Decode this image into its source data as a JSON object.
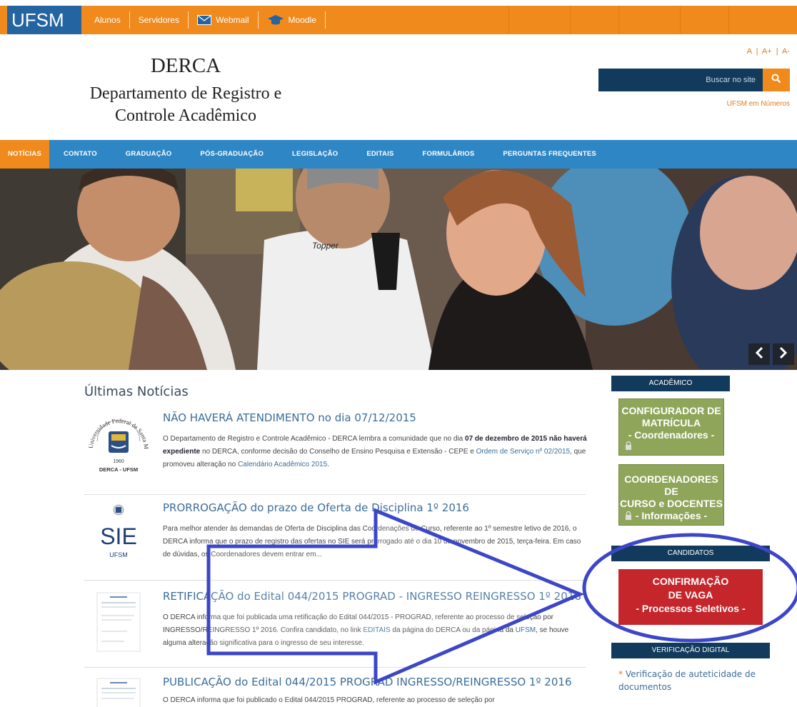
{
  "topbar": {
    "logo": "UFSM",
    "links": [
      "Alunos",
      "Servidores",
      "Webmail",
      "Moodle"
    ]
  },
  "header": {
    "title": "DERCA",
    "subtitle_line1": "Departamento de Registro e",
    "subtitle_line2": "Controle Acadêmico",
    "font_sizes": "A  |  A+  |  A-",
    "search_placeholder": "Buscar no site",
    "ufsm_numeros": "UFSM em Números"
  },
  "nav": {
    "items": [
      "NOTÍCIAS",
      "CONTATO",
      "GRADUAÇÃO",
      "PÓS-GRADUAÇÃO",
      "LEGISLAÇÃO",
      "EDITAIS",
      "FORMULÁRIOS",
      "PERGUNTAS FREQUENTES"
    ],
    "active": "NOTÍCIAS"
  },
  "hero": {
    "shirt_text": "Topper"
  },
  "news": {
    "heading": "Últimas Notícias",
    "items": [
      {
        "title": "NÃO HAVERÁ ATENDIMENTO no dia 07/12/2015",
        "text_1": "O Departamento de Registro e Controle Acadêmico - DERCA lembra a comunidade que no dia ",
        "bold_1": "07 de dezembro de 2015 não haverá expediente",
        "text_2": " no DERCA, conforme decisão do Conselho de Ensino Pesquisa e Extensão - CEPE e ",
        "link_1": "Ordem de Serviço nº 02/2015",
        "text_3": ", que promoveu alteração no ",
        "link_2": "Calendário Acadêmico 2015",
        "text_4": ".",
        "thumb_seal_text": "Universidade Federal de Santa Maria",
        "thumb_year": "1960",
        "thumb_caption": "DERCA - UFSM"
      },
      {
        "title": "PRORROGAÇÃO do prazo de Oferta de Disciplina 1º 2016",
        "text": "Para melhor atender às demandas de Oferta de Disciplina das Coordenações de Curso, referente ao 1º semestre letivo de 2016, o DERCA informa que o prazo de registro das ofertas no SIE será prorrogado até o dia 10 de novembro de 2015, terça-feira. Em caso de dúvidas, os Coordenadores devem entrar em...",
        "thumb_big": "SIE",
        "thumb_small": "UFSM"
      },
      {
        "title": "RETIFICAÇÃO do Edital 044/2015 PROGRAD - INGRESSO REINGRESSO 1º 2016",
        "text_1": "O DERCA informa que foi publicada uma retificação do Edital 044/2015 - PROGRAD, referente ao processo de seleção por INGRESSO/REINGRESSO 1º 2016. Confira candidato, no link ",
        "link_1": "EDITAIS",
        "text_2": " da página do DERCA ou da página da ",
        "link_2": "UFSM",
        "text_3": ", se houve alguma alteração significativa para o ingresso de seu interesse."
      },
      {
        "title": "PUBLICAÇÃO do Edital 044/2015 PROGRAD INGRESSO/REINGRESSO 1º 2016",
        "text": "O DERCA informa que foi publicado o Edital 044/2015 PROGRAD, referente ao processo de seleção por"
      }
    ]
  },
  "sidebar": {
    "academico_head": "ACADÊMICO",
    "box1": [
      "CONFIGURADOR DE",
      "MATRÍCULA",
      "- Coordenadores -"
    ],
    "box2": [
      "COORDENADORES DE",
      "CURSO e DOCENTES",
      "- Informações -"
    ],
    "candidatos_head": "CANDIDATOS",
    "red_box": [
      "CONFIRMAÇÃO",
      "DE VAGA",
      "- Processos Seletivos -"
    ],
    "verificacao_head": "VERIFICAÇÃO DIGITAL",
    "verificacao_link": "Verificação de auteticidade de documentos"
  },
  "colors": {
    "orange": "#f08a1c",
    "navy": "#123a5c",
    "blue_nav": "#2f86c4",
    "green_box": "#8fa65a",
    "red_box": "#c4262c",
    "annotation_blue": "#3c46c8"
  },
  "icons": [
    "envelope-icon",
    "graduation-cap-icon",
    "search-icon",
    "lock-icon",
    "chevron-left-icon",
    "chevron-right-icon"
  ]
}
